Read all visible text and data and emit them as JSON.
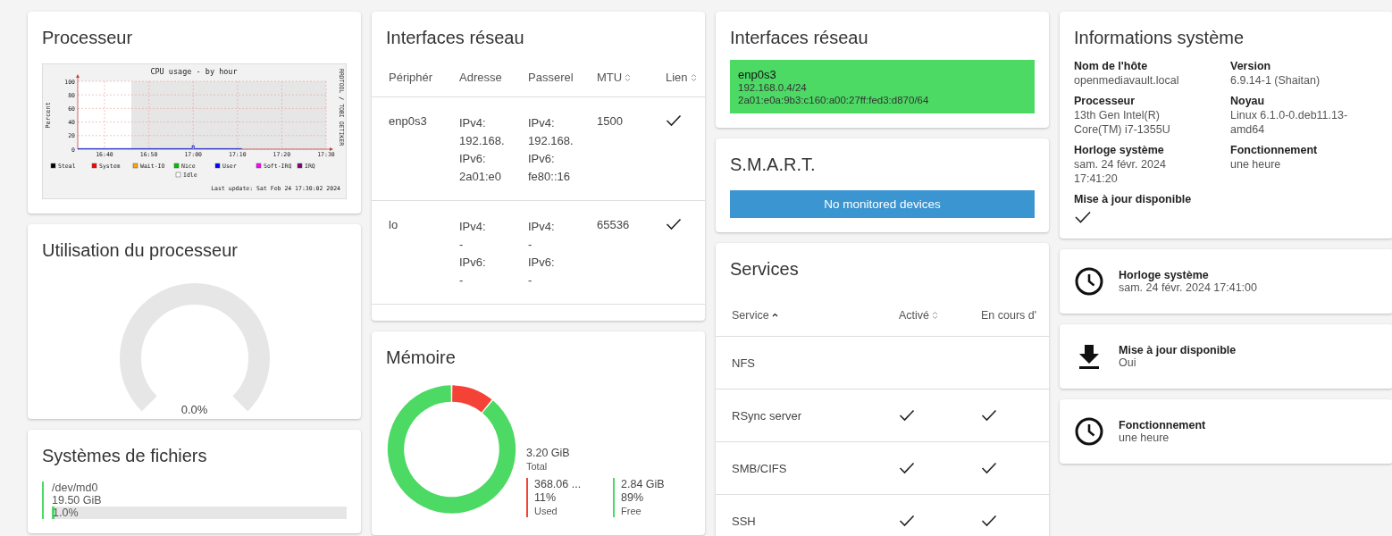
{
  "processor": {
    "title": "Processeur",
    "graph": {
      "title": "CPU usage - by hour",
      "ylabel": "Percent",
      "x_ticks": [
        "16:40",
        "16:50",
        "17:00",
        "17:10",
        "17:20",
        "17:30"
      ],
      "y_ticks": [
        "100",
        "80",
        "60",
        "40",
        "20",
        "0"
      ],
      "legend": [
        {
          "name": "Steal",
          "color": "#000000"
        },
        {
          "name": "System",
          "color": "#ff0000"
        },
        {
          "name": "Wait-IO",
          "color": "#ffa500"
        },
        {
          "name": "Nice",
          "color": "#00c000"
        },
        {
          "name": "User",
          "color": "#0000ff"
        },
        {
          "name": "Soft-IRQ",
          "color": "#ff00ff"
        },
        {
          "name": "IRQ",
          "color": "#800080"
        },
        {
          "name": "Idle",
          "color": "#ffffff"
        }
      ],
      "last_update": "Last update: Sat Feb 24 17:30:02 2024",
      "side_label": "RRDTOOL / TOBI OETIKER"
    }
  },
  "cpu_usage": {
    "title": "Utilisation du processeur",
    "reading": "0.0%"
  },
  "filesystems": {
    "title": "Systèmes de fichiers",
    "items": [
      {
        "device": "/dev/md0",
        "size": "19.50 GiB",
        "level": 0.01,
        "reading": "1.0%"
      }
    ]
  },
  "network_table": {
    "title": "Interfaces réseau",
    "columns": [
      {
        "label": "Périphér",
        "sortable": false
      },
      {
        "label": "Adresse",
        "sortable": false
      },
      {
        "label": "Passerel",
        "sortable": false
      },
      {
        "label": "MTU",
        "sortable": true
      },
      {
        "label": "Lien",
        "sortable": true
      }
    ],
    "rows": [
      {
        "device": "enp0s3",
        "address": [
          "IPv4:",
          "192.168.",
          "IPv6:",
          "2a01:e0"
        ],
        "gateway": [
          "IPv4:",
          "192.168.",
          "IPv6:",
          "fe80::16"
        ],
        "mtu": "1500",
        "link": true
      },
      {
        "device": "lo",
        "address": [
          "IPv4:",
          "-",
          "IPv6:",
          "-"
        ],
        "gateway": [
          "IPv4:",
          "-",
          "IPv6:",
          "-"
        ],
        "mtu": "65536",
        "link": true
      }
    ]
  },
  "memory": {
    "title": "Mémoire",
    "chart_data": {
      "type": "donut",
      "categories": [
        "Used",
        "Free"
      ],
      "values": [
        11,
        89
      ]
    },
    "total": "3.20 GiB",
    "total_label": "Total",
    "parts": [
      {
        "amount": "368.06 ...",
        "percent": "11%",
        "color": "#f44336"
      },
      {
        "amount": "2.84 GiB",
        "percent": "89%",
        "color": "#4cd964"
      }
    ]
  },
  "network_summary": {
    "title": "Interfaces réseau",
    "interfaces": [
      {
        "name": "enp0s3",
        "lines": [
          "192.168.0.4/24",
          "2a01:e0a:9b3:c160:a00:27ff:fed3:d870/64"
        ],
        "color": "#4cd964"
      }
    ]
  },
  "smart": {
    "title": "S.M.A.R.T.",
    "message": "No monitored devices"
  },
  "services": {
    "title": "Services",
    "columns": [
      {
        "label": "Service",
        "sortable": true,
        "sorted": true
      },
      {
        "label": "Activé",
        "sortable": true,
        "sorted": false
      },
      {
        "label": "En cours d'",
        "sortable": false
      }
    ],
    "rows": [
      {
        "name": "NFS",
        "enabled": false,
        "running": false
      },
      {
        "name": "RSync server",
        "enabled": true,
        "running": true
      },
      {
        "name": "SMB/CIFS",
        "enabled": true,
        "running": true
      },
      {
        "name": "SSH",
        "enabled": true,
        "running": true
      }
    ]
  },
  "system_info": {
    "title": "Informations système",
    "fields": [
      {
        "label": "Nom de l'hôte",
        "value": "openmediavault.local"
      },
      {
        "label": "Version",
        "value": "6.9.14-1 (Shaitan)"
      },
      {
        "label": "Processeur",
        "value": "13th Gen Intel(R) Core(TM) i7-1355U"
      },
      {
        "label": "Noyau",
        "value": "Linux 6.1.0-0.deb11.13-amd64"
      },
      {
        "label": "Horloge système",
        "value": "sam. 24 févr. 2024 17:41:20"
      },
      {
        "label": "Fonctionnement",
        "value": "une heure"
      }
    ],
    "update_label": "Mise à jour disponible",
    "update_available": true
  },
  "tiles": [
    {
      "kind": "clock",
      "label": "Horloge système",
      "value": "sam. 24 févr. 2024 17:41:00"
    },
    {
      "kind": "download",
      "label": "Mise à jour disponible",
      "value": "Oui"
    },
    {
      "kind": "clock",
      "label": "Fonctionnement",
      "value": "une heure"
    }
  ]
}
